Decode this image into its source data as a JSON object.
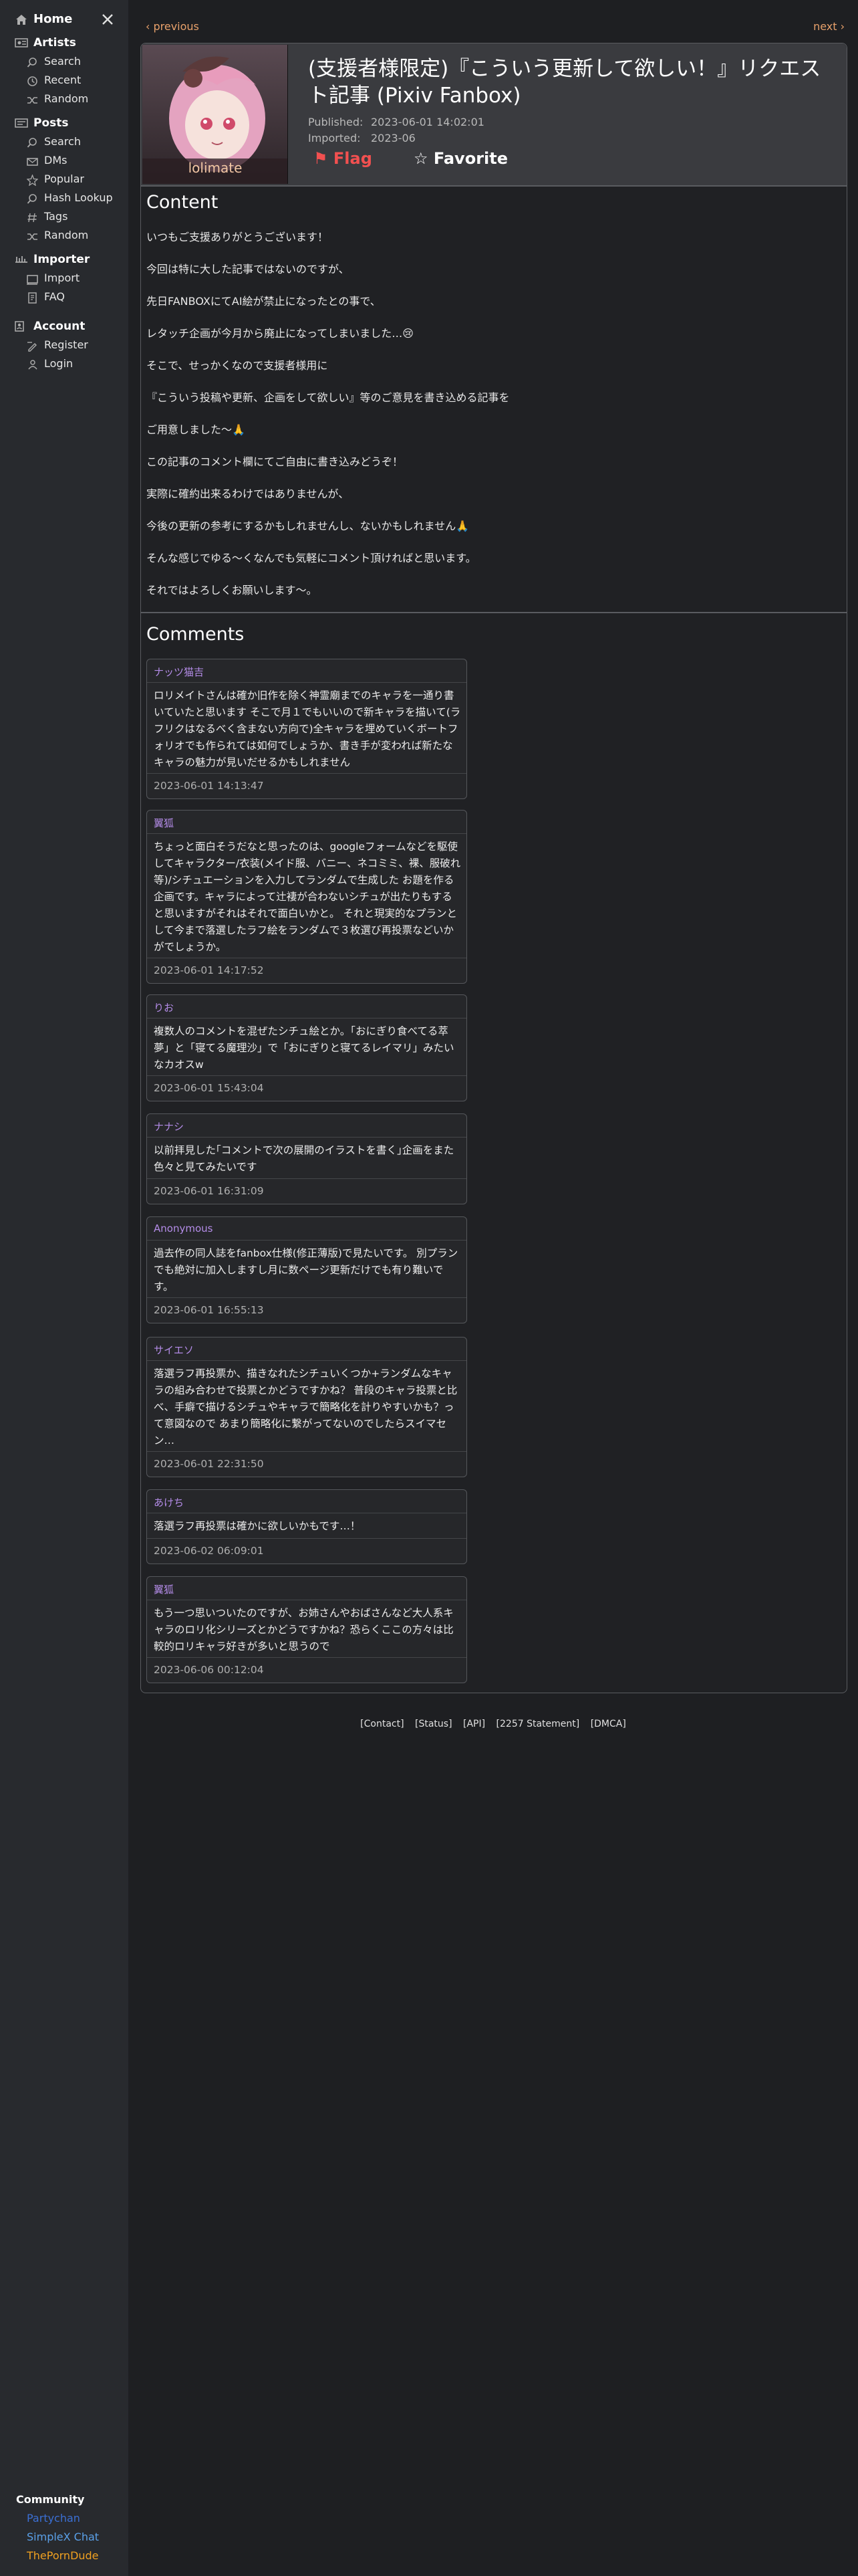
{
  "sidebar": {
    "home": "Home",
    "sections": [
      {
        "label": "Artists",
        "items": [
          "Search",
          "Recent",
          "Random"
        ]
      },
      {
        "label": "Posts",
        "items": [
          "Search",
          "DMs",
          "Popular",
          "Hash Lookup",
          "Tags",
          "Random"
        ]
      },
      {
        "label": "Importer",
        "items": [
          "Import",
          "FAQ"
        ]
      },
      {
        "label": "Account",
        "items": [
          "Register",
          "Login"
        ]
      }
    ],
    "community": {
      "heading": "Community",
      "links": [
        {
          "label": "Partychan",
          "color": "#3b6fd4"
        },
        {
          "label": "SimpleX Chat",
          "color": "#5aa0e8"
        },
        {
          "label": "ThePornDude",
          "color": "#f0a020"
        }
      ]
    }
  },
  "nav": {
    "previous": "‹ previous",
    "next": "next ›"
  },
  "post": {
    "artist_name": "lolimate",
    "title": "(支援者様限定)『こういう更新して欲しい！』リクエスト記事 (Pixiv Fanbox)",
    "published_label": "Published:",
    "published_value": "2023-06-01 14:02:01",
    "imported_label": "Imported:",
    "imported_value": "2023-06",
    "flag_label": "⚑ Flag",
    "favorite_label": "☆ Favorite"
  },
  "content": {
    "heading": "Content",
    "paragraphs": [
      "いつもご支援ありがとうございます！",
      "今回は特に大した記事ではないのですが、",
      "先日FANBOXにてAI絵が禁止になったとの事で、",
      "レタッチ企画が今月から廃止になってしまいました…😢",
      "そこで、せっかくなので支援者様用に",
      "『こういう投稿や更新、企画をして欲しい』等のご意見を書き込める記事を",
      "ご用意しました〜🙏",
      "この記事のコメント欄にてご自由に書き込みどうぞ！",
      "実際に確約出来るわけではありませんが、",
      "今後の更新の参考にするかもしれませんし、ないかもしれません🙏",
      "そんな感じでゆる〜くなんでも気軽にコメント頂ければと思います。",
      "それではよろしくお願いします〜。"
    ]
  },
  "comments": {
    "heading": "Comments",
    "items": [
      {
        "author": "ナッツ猫吉",
        "body": "ロリメイトさんは確か旧作を除く神霊廟までのキャラを一通り書いていたと思います そこで月１でもいいので新キャラを描いて(ラフリクはなるべく含まない方向で)全キャラを埋めていくボートフォリオでも作られては如何でしょうか、書き手が変われば新たなキャラの魅力が見いだせるかもしれません",
        "date": "2023-06-01 14:13:47"
      },
      {
        "author": "翼狐",
        "body": "ちょっと面白そうだなと思ったのは、googleフォームなどを駆使してキャラクター/衣装(メイド服、バニー、ネコミミ、裸、服破れ等)/シチュエーションを入力してランダムで生成した お題を作る企画です。キャラによって辻褄が合わないシチュが出たりもすると思いますがそれはそれで面白いかと。 それと現実的なプランとして今まで落選したラフ絵をランダムで３枚選び再投票などいかがでしょうか。",
        "date": "2023-06-01 14:17:52"
      },
      {
        "author": "りお",
        "body": "複数人のコメントを混ぜたシチュ絵とか。「おにぎり食べてる萃夢」と「寝てる魔理沙」で「おにぎりと寝てるレイマリ」みたいなカオスw",
        "date": "2023-06-01 15:43:04"
      },
      {
        "author": "ナナシ",
        "body": "以前拝見した｢コメントで次の展開のイラストを書く｣企画をまた色々と見てみたいです",
        "date": "2023-06-01 16:31:09"
      },
      {
        "author": "Anonymous",
        "body": "過去作の同人誌をfanbox仕様(修正薄版)で見たいです。 別プランでも絶対に加入しますし月に数ページ更新だけでも有り難いです。",
        "date": "2023-06-01 16:55:13"
      },
      {
        "author": "サイエソ",
        "body": "落選ラフ再投票か、描きなれたシチュいくつか+ランダムなキャラの組み合わせで投票とかどうですかね？ 普段のキャラ投票と比べ、手癖で描けるシチュやキャラで簡略化を計りやすいかも？って意図なので あまり簡略化に繋がってないのでしたらスイマセン…",
        "date": "2023-06-01 22:31:50"
      },
      {
        "author": "あけち",
        "body": "落選ラフ再投票は確かに欲しいかもです…！",
        "date": "2023-06-02 06:09:01"
      },
      {
        "author": "翼狐",
        "body": "もう一つ思いついたのですが、お姉さんやおばさんなど大人系キャラのロリ化シリーズとかどうですかね？恐らくここの方々は比較的ロリキャラ好きが多いと思うので",
        "date": "2023-06-06 00:12:04"
      }
    ]
  },
  "footer": {
    "links": [
      "[Contact]",
      "[Status]",
      "[API]",
      "[2257 Statement]",
      "[DMCA]"
    ]
  },
  "colors": {
    "accent": "#e8a16b",
    "author": "#b48ce8",
    "flag": "#f25050"
  }
}
